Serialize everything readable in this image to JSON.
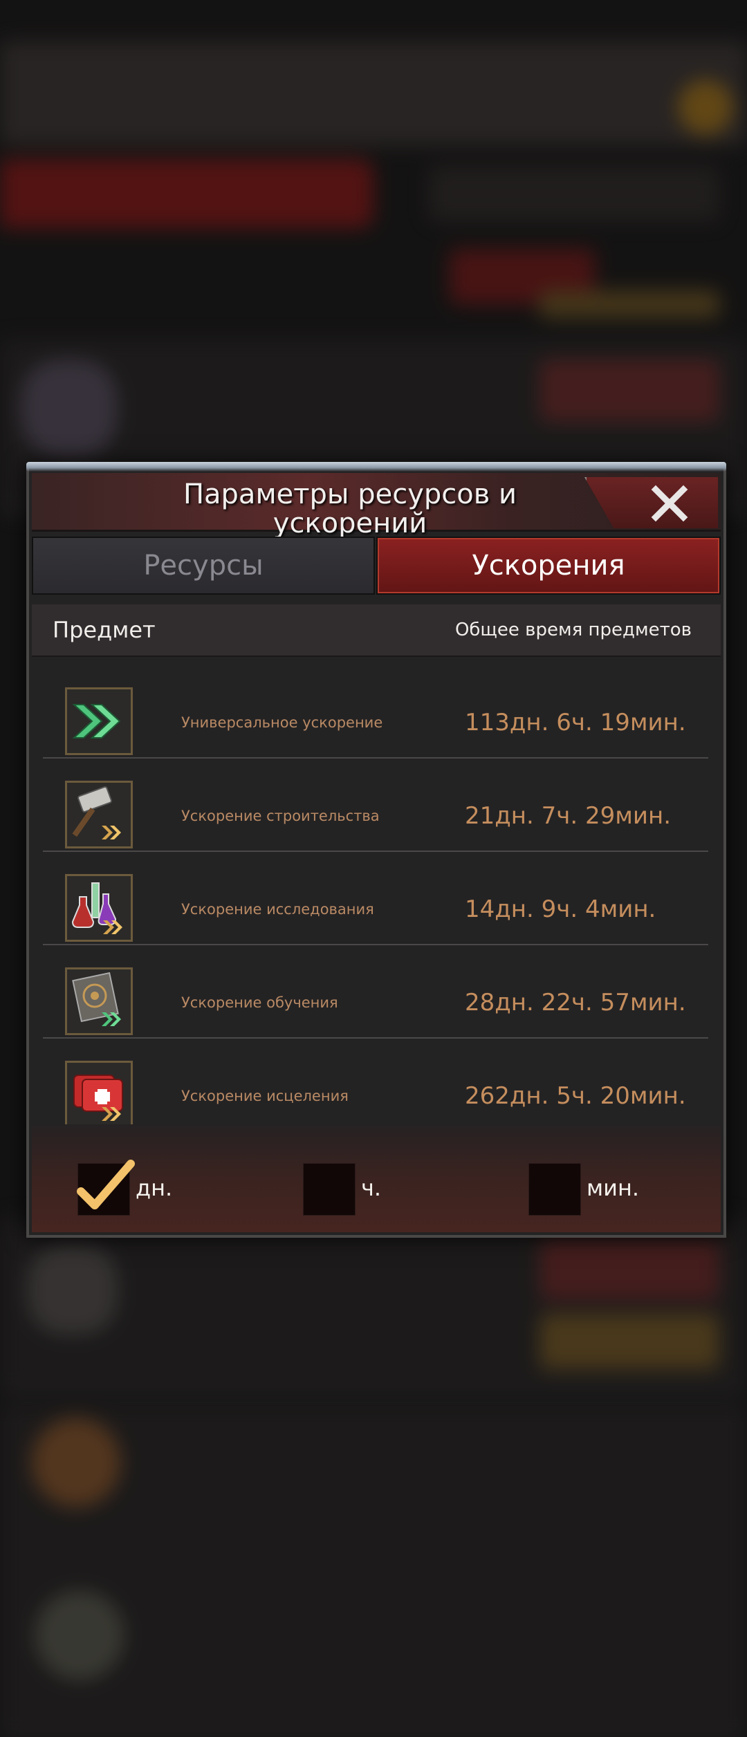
{
  "dialog": {
    "title": "Параметры ресурсов и ускорений",
    "close_icon": "close-icon",
    "tabs": [
      {
        "label": "Ресурсы",
        "active": false
      },
      {
        "label": "Ускорения",
        "active": true
      }
    ],
    "columns": {
      "item": "Предмет",
      "total_time": "Общее время предметов"
    },
    "items": [
      {
        "name": "Универсальное ускорение",
        "time": "113дн. 6ч. 19мин.",
        "icon": "universal-speedup-icon"
      },
      {
        "name": "Ускорение строительства",
        "time": "21дн. 7ч. 29мин.",
        "icon": "construction-hammer-icon"
      },
      {
        "name": "Ускорение исследования",
        "time": "14дн. 9ч. 4мин.",
        "icon": "research-flasks-icon"
      },
      {
        "name": "Ускорение обучения",
        "time": "28дн. 22ч. 57мин.",
        "icon": "training-target-icon"
      },
      {
        "name": "Ускорение исцеления",
        "time": "262дн. 5ч. 20мин.",
        "icon": "healing-kit-icon"
      }
    ],
    "units": [
      {
        "label": "дн.",
        "checked": true
      },
      {
        "label": "ч.",
        "checked": false
      },
      {
        "label": "мин.",
        "checked": false
      }
    ]
  },
  "colors": {
    "accent_red": "#8b2121",
    "time_text": "#c58e5d",
    "check": "#f3c26a"
  }
}
